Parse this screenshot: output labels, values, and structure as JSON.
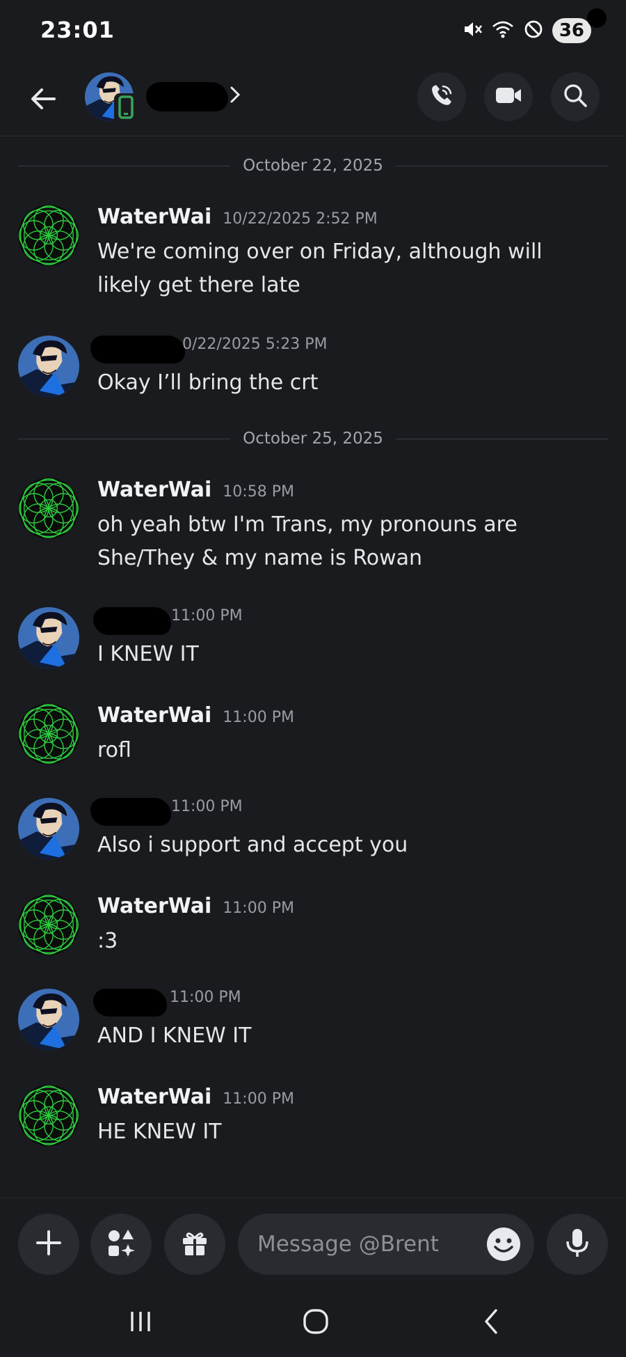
{
  "status_bar": {
    "time": "23:01",
    "battery": "36",
    "icons": [
      "mute-icon",
      "wifi-icon",
      "do-not-disturb-icon"
    ]
  },
  "header": {
    "icons": [
      "back-arrow-icon",
      "chevron-right-icon",
      "voice-call-icon",
      "video-call-icon",
      "search-icon"
    ]
  },
  "chat": {
    "dividers": [
      "October 22, 2025",
      "October 25, 2025"
    ],
    "messages": [
      {
        "author": "WaterWai",
        "time": "10/22/2025 2:52 PM",
        "text": "We're coming over on Friday, although will likely get there late"
      },
      {
        "author": "",
        "time": "0/22/2025 5:23 PM",
        "text": "Okay I’ll bring the crt"
      },
      {
        "author": "WaterWai",
        "time": "10:58 PM",
        "text": "oh yeah btw I'm Trans, my pronouns are She/They & my name is Rowan"
      },
      {
        "author": "",
        "time": "11:00 PM",
        "text": "I KNEW IT"
      },
      {
        "author": "WaterWai",
        "time": "11:00 PM",
        "text": "rofl"
      },
      {
        "author": "",
        "time": "11:00 PM",
        "text": "Also i support and accept you"
      },
      {
        "author": "WaterWai",
        "time": "11:00 PM",
        "text": ":3"
      },
      {
        "author": "",
        "time": "11:00 PM",
        "text": "AND I KNEW IT"
      },
      {
        "author": "WaterWai",
        "time": "11:00 PM",
        "text": "HE KNEW IT"
      }
    ]
  },
  "composer": {
    "placeholder": "Message @Brent",
    "icons": [
      "plus-icon",
      "apps-icon",
      "gift-icon",
      "emoji-icon",
      "microphone-icon"
    ]
  },
  "colors": {
    "background": "#1a1b1f",
    "accent_green": "#3ba55c",
    "mandala_green": "#2ecc40"
  }
}
